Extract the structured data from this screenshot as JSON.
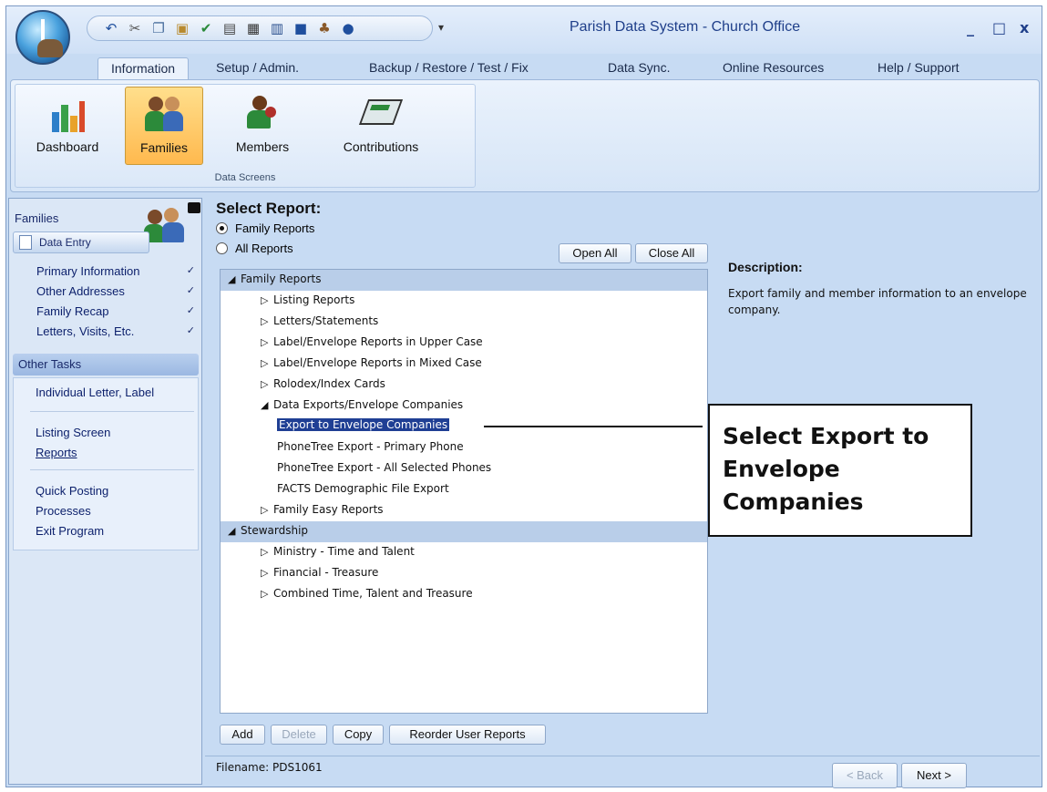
{
  "window": {
    "title": "Parish Data System - Church Office",
    "controls": [
      "_",
      "□",
      "x"
    ]
  },
  "quick_access": {
    "icons": [
      "undo-icon",
      "cut-icon",
      "copy-icon",
      "paste-icon",
      "spellcheck-icon",
      "print-icon",
      "calculator-icon",
      "calendar-icon",
      "book-icon",
      "users-icon",
      "help-icon"
    ],
    "more": "▾"
  },
  "tabs": [
    "Information",
    "Setup / Admin.",
    "Backup / Restore / Test / Fix",
    "Data Sync.",
    "Online Resources",
    "Help / Support"
  ],
  "ribbon": {
    "buttons": [
      "Dashboard",
      "Families",
      "Members",
      "Contributions"
    ],
    "group_label": "Data Screens"
  },
  "left_pane": {
    "title": "Families",
    "data_entry": "Data Entry",
    "data_entry_items": [
      {
        "label": "Primary Information",
        "check": "✓"
      },
      {
        "label": "Other Addresses",
        "check": "✓"
      },
      {
        "label": "Family Recap",
        "check": "✓"
      },
      {
        "label": "Letters, Visits, Etc.",
        "check": "✓"
      }
    ],
    "other_tasks": "Other Tasks",
    "tasks": [
      "Individual Letter, Label",
      "Listing Screen",
      "Reports",
      "Quick Posting",
      "Processes",
      "Exit Program"
    ]
  },
  "main": {
    "select_report": "Select Report:",
    "radio_family": "Family Reports",
    "radio_all": "All Reports",
    "open_all": "Open All",
    "close_all": "Close All",
    "tree": [
      {
        "label": "Family Reports",
        "tri": "◢",
        "header": true
      },
      {
        "label": "Listing Reports",
        "tri": "▷"
      },
      {
        "label": "Letters/Statements",
        "tri": "▷"
      },
      {
        "label": "Label/Envelope Reports in Upper Case",
        "tri": "▷"
      },
      {
        "label": "Label/Envelope Reports in Mixed Case",
        "tri": "▷"
      },
      {
        "label": "Rolodex/Index Cards",
        "tri": "▷"
      },
      {
        "label": "Data Exports/Envelope Companies",
        "tri": "◢"
      },
      {
        "label": "Export to Envelope Companies",
        "tri": ""
      },
      {
        "label": "PhoneTree Export - Primary Phone",
        "tri": ""
      },
      {
        "label": "PhoneTree Export - All Selected Phones",
        "tri": ""
      },
      {
        "label": "FACTS Demographic File Export",
        "tri": ""
      },
      {
        "label": "Family Easy Reports",
        "tri": "▷"
      },
      {
        "label": "Stewardship",
        "tri": "◢",
        "header": true
      },
      {
        "label": "Ministry - Time and Talent",
        "tri": "▷"
      },
      {
        "label": "Financial - Treasure",
        "tri": "▷"
      },
      {
        "label": "Combined Time, Talent and Treasure",
        "tri": "▷"
      }
    ],
    "description_title": "Description:",
    "description_text": "Export family and member information to an envelope company.",
    "callout": "Select Export to Envelope Companies",
    "buttons": {
      "add": "Add",
      "delete": "Delete",
      "copy": "Copy",
      "reorder": "Reorder User Reports"
    },
    "filename": "Filename: PDS1061",
    "back": "< Back",
    "next": "Next >"
  }
}
